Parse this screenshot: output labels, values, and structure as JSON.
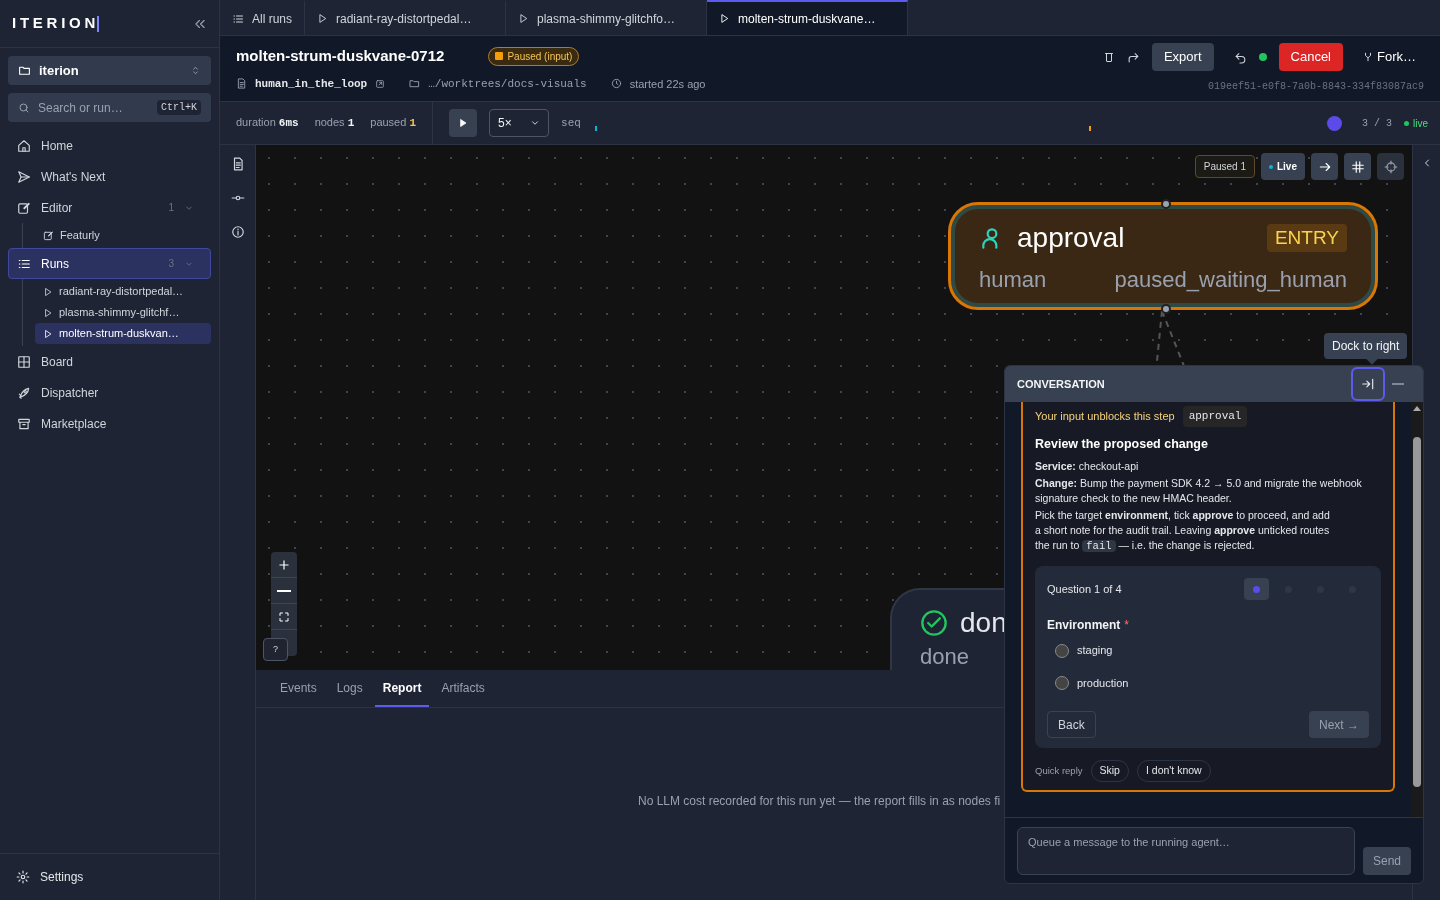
{
  "sidebar": {
    "logo": "ITERION",
    "workspace": "iterion",
    "search": {
      "placeholder": "Search or run…",
      "shortcut": "Ctrl+K"
    },
    "items": [
      {
        "label": "Home",
        "selected": false
      },
      {
        "label": "What's Next",
        "selected": false
      },
      {
        "label": "Editor",
        "count": "1",
        "selected": false,
        "expanded": true,
        "children": [
          {
            "label": "Featurly",
            "kind": "doc",
            "selected": false
          }
        ]
      },
      {
        "label": "Runs",
        "count": "3",
        "selected": true,
        "expanded": true,
        "children": [
          {
            "label": "radiant-ray-distortpedal…",
            "kind": "run",
            "selected": false
          },
          {
            "label": "plasma-shimmy-glitchf…",
            "kind": "run",
            "selected": false
          },
          {
            "label": "molten-strum-duskvan…",
            "kind": "run",
            "selected": true
          }
        ]
      },
      {
        "label": "Board",
        "selected": false
      },
      {
        "label": "Dispatcher",
        "selected": false
      },
      {
        "label": "Marketplace",
        "selected": false
      }
    ],
    "footer": "Settings"
  },
  "tabs": [
    {
      "label": "All runs",
      "kind": "list",
      "selected": false
    },
    {
      "label": "radiant-ray-distortpedal…",
      "kind": "run",
      "selected": false
    },
    {
      "label": "plasma-shimmy-glitchfo…",
      "kind": "run",
      "selected": false
    },
    {
      "label": "molten-strum-duskvane…",
      "kind": "run",
      "selected": true
    }
  ],
  "header": {
    "title": "molten-strum-duskvane-0712",
    "status": "Paused (input)",
    "workflow": "human_in_the_loop",
    "path": "…/worktrees/docs-visuals",
    "started": "started 22s ago",
    "export": "Export",
    "cancel": "Cancel",
    "fork": "Fork…",
    "run_id": "019eef51-e0f8-7a0b-8843-334f83087ac9"
  },
  "toolbar": {
    "stats": [
      {
        "label": "duration",
        "value": "6ms"
      },
      {
        "label": "nodes",
        "value": "1"
      },
      {
        "label": "paused",
        "value": "1"
      }
    ],
    "speed": "5×",
    "seq": "seq",
    "position": "3 / 3",
    "live": "live"
  },
  "canvas": {
    "paused_badge": "Paused 1",
    "live_button": "Live",
    "nodes": [
      {
        "title": "approval",
        "type": "human",
        "badge": "ENTRY",
        "state": "paused_waiting_human",
        "kind": "human"
      },
      {
        "title": "don",
        "type": "done",
        "kind": "done"
      }
    ],
    "help": "?"
  },
  "bottom_tabs": [
    {
      "label": "Events",
      "selected": false
    },
    {
      "label": "Logs",
      "selected": false
    },
    {
      "label": "Report",
      "selected": true
    },
    {
      "label": "Artifacts",
      "selected": false
    }
  ],
  "report_empty": "No LLM cost recorded for this run yet — the report fills in as nodes fi",
  "tooltip": "Dock to right",
  "conversation": {
    "title": "CONVERSATION",
    "unblocks": "Your input unblocks this step",
    "node": "approval",
    "heading": "Review the proposed change",
    "paragraphs": [
      {
        "before": "**Service:** checkout-api"
      },
      {
        "before": "**Change:** Bump the payment SDK 4.2 → 5.0 and migrate the webhook signature check to the new HMAC header."
      },
      {
        "before": "Pick the target **environment**, tick **approve** to proceed, and add\na short note for the audit trail. Leaving **approve** unticked routes\nthe run to ",
        "code": "fail",
        "after": " — i.e. the change is rejected."
      }
    ],
    "question": {
      "progress": "Question 1 of 4",
      "steps": [
        {
          "selected": true
        },
        {
          "selected": false
        },
        {
          "selected": false
        },
        {
          "selected": false
        }
      ],
      "field": "Environment",
      "required": "*",
      "options": [
        {
          "label": "staging",
          "checked": false
        },
        {
          "label": "production",
          "checked": false
        }
      ],
      "back": "Back",
      "next": "Next →"
    },
    "quick_label": "Quick reply",
    "quick": [
      "Skip",
      "I don't know"
    ],
    "input": {
      "placeholder": "Queue a message to the running agent…"
    },
    "send": "Send"
  }
}
